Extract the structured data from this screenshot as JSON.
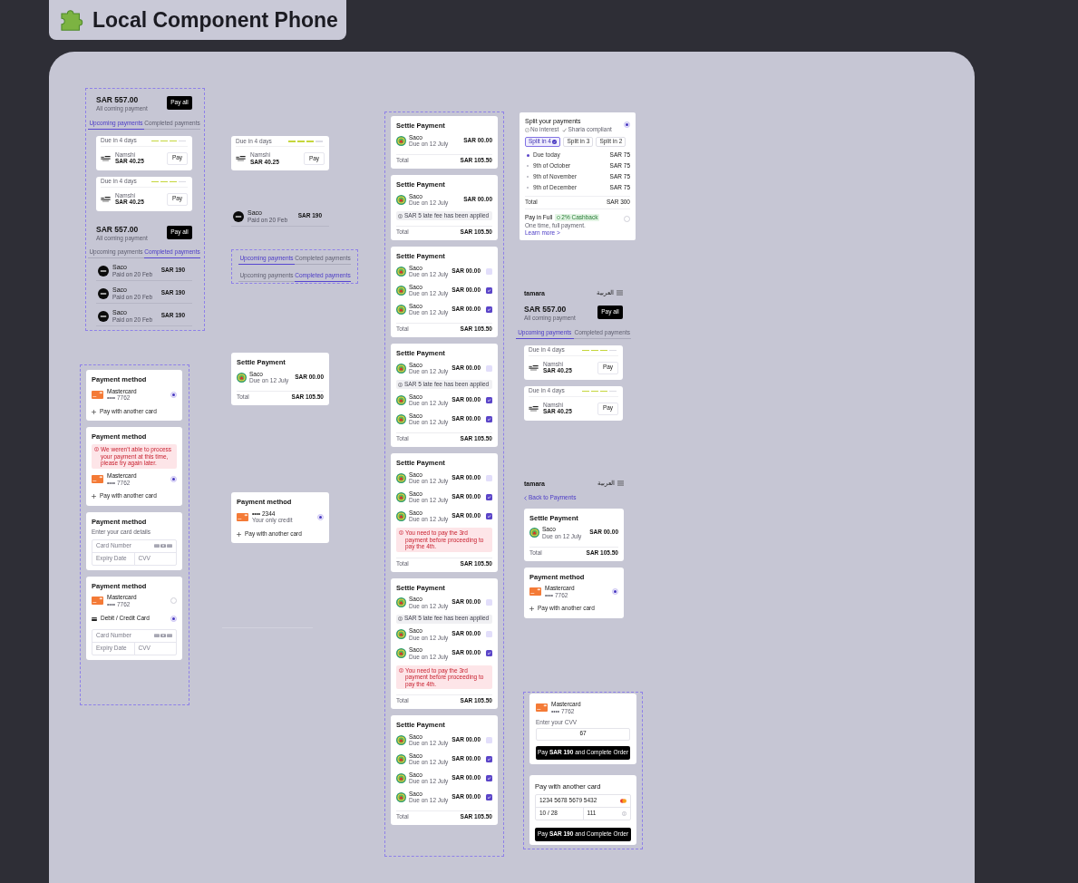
{
  "header": {
    "title": "Local Component Phone"
  },
  "frames": [
    {
      "kind": "section",
      "items": [
        {
          "kind": "balance",
          "amount": "SAR 557.00",
          "caption": "All coming payment",
          "button": "Pay all"
        },
        {
          "kind": "tabs",
          "tabs": [
            {
              "label": "Upcoming payments",
              "selected": true
            },
            {
              "label": "Completed payments",
              "selected": false
            }
          ]
        },
        {
          "kind": "due_card",
          "due": "Due in 4 days",
          "level": 0.75,
          "merchant": "Namshi",
          "amount": "SAR 40.25",
          "button": "Pay"
        },
        {
          "kind": "due_card",
          "due": "Due in 4 days",
          "level": 0.75,
          "merchant": "Namshi",
          "amount": "SAR 40.25",
          "button": "Pay"
        },
        {
          "kind": "balance",
          "amount": "SAR 557.00",
          "caption": "All coming payment",
          "button": "Pay all"
        },
        {
          "kind": "tabs",
          "tabs": [
            {
              "label": "Upcoming payments",
              "selected": false
            },
            {
              "label": "Completed payments",
              "selected": true
            }
          ]
        },
        {
          "kind": "paid_row",
          "merchant": "Saco",
          "date": "Paid on 20 Feb",
          "amount": "SAR 190"
        },
        {
          "kind": "paid_row",
          "merchant": "Saco",
          "date": "Paid on 20 Feb",
          "amount": "SAR 190"
        },
        {
          "kind": "paid_row",
          "merchant": "Saco",
          "date": "Paid on 20 Feb",
          "amount": "SAR 190"
        }
      ]
    },
    {
      "kind": "section",
      "items": [
        {
          "kind": "method_card",
          "title": "Payment method",
          "items": [
            {
              "kind": "saved_card",
              "title": "Mastercard",
              "subtitle": "•••• 7762",
              "selected": true
            },
            {
              "kind": "add_card",
              "label": "Pay with another card"
            }
          ]
        },
        {
          "kind": "method_card",
          "title": "Payment method",
          "items": [
            {
              "kind": "error",
              "text": "We weren't able to process your payment at this time, please try again later."
            },
            {
              "kind": "saved_card",
              "title": "Mastercard",
              "subtitle": "•••• 7762",
              "selected": true
            },
            {
              "kind": "add_card",
              "label": "Pay with another card"
            }
          ]
        },
        {
          "kind": "method_card",
          "title": "Payment method",
          "items": [
            {
              "kind": "hint",
              "text": "Enter your card details"
            },
            {
              "kind": "card_form",
              "fields": [
                {
                  "placeholder": "Card Number"
                },
                {
                  "placeholder": "Expiry Date"
                },
                {
                  "placeholder": "CVV"
                }
              ]
            }
          ]
        },
        {
          "kind": "method_card",
          "title": "Payment method",
          "items": [
            {
              "kind": "saved_card",
              "title": "Mastercard",
              "subtitle": "•••• 7762",
              "selected": false
            },
            {
              "kind": "new_card",
              "label": "Debit / Credit Card",
              "selected": true
            },
            {
              "kind": "card_form",
              "fields": [
                {
                  "placeholder": "Card Number"
                },
                {
                  "placeholder": "Expiry Date"
                },
                {
                  "placeholder": "CVV"
                }
              ]
            }
          ]
        }
      ]
    },
    {
      "kind": "due_card",
      "due": "Due in 4 days",
      "level": 0.75,
      "merchant": "Namshi",
      "amount": "SAR 40.25",
      "button": "Pay"
    },
    {
      "kind": "paid_row",
      "merchant": "Saco",
      "date": "Paid on 20 Feb",
      "amount": "SAR 190"
    },
    {
      "kind": "section",
      "items": [
        {
          "kind": "tabs",
          "tabs": [
            {
              "label": "Upcoming payments",
              "selected": true
            },
            {
              "label": "Completed payments",
              "selected": false
            }
          ]
        },
        {
          "kind": "tabs",
          "tabs": [
            {
              "label": "Upcoming payments",
              "selected": false
            },
            {
              "label": "Completed payments",
              "selected": true
            }
          ]
        }
      ]
    },
    {
      "kind": "settle_card",
      "title": "Settle Payment",
      "items": [
        {
          "kind": "payment",
          "merchant": "Saco",
          "date": "Due on 12 July",
          "amount": "SAR 00.00"
        }
      ],
      "total_label": "Total",
      "total": "SAR 105.50"
    },
    {
      "kind": "method_card",
      "title": "Payment method",
      "items": [
        {
          "kind": "saved_card",
          "title": "•••• 2344",
          "subtitle": "Your only credit",
          "selected": true
        },
        {
          "kind": "add_card",
          "label": "Pay with another card"
        }
      ]
    },
    {
      "kind": "section",
      "items": [
        {
          "kind": "settle_card",
          "title": "Settle Payment",
          "items": [
            {
              "kind": "payment",
              "merchant": "Saco",
              "date": "Due on 12 July",
              "amount": "SAR 00.00"
            }
          ],
          "total_label": "Total",
          "total": "SAR 105.50"
        },
        {
          "kind": "settle_card",
          "title": "Settle Payment",
          "items": [
            {
              "kind": "payment",
              "merchant": "Saco",
              "date": "Due on 12 July",
              "amount": "SAR 00.00"
            },
            {
              "kind": "info",
              "text": "SAR 5 late fee has been applied"
            }
          ],
          "total_label": "Total",
          "total": "SAR 105.50"
        },
        {
          "kind": "settle_card",
          "title": "Settle Payment",
          "items": [
            {
              "kind": "payment",
              "merchant": "Saco",
              "date": "Due on 12 July",
              "amount": "SAR 00.00",
              "checked": false
            },
            {
              "kind": "payment",
              "merchant": "Saco",
              "date": "Due on 12 July",
              "amount": "SAR 00.00",
              "checked": true
            },
            {
              "kind": "payment",
              "merchant": "Saco",
              "date": "Due on 12 July",
              "amount": "SAR 00.00",
              "checked": true
            }
          ],
          "total_label": "Total",
          "total": "SAR 105.50"
        },
        {
          "kind": "settle_card",
          "title": "Settle Payment",
          "items": [
            {
              "kind": "payment",
              "merchant": "Saco",
              "date": "Due on 12 July",
              "amount": "SAR 00.00",
              "checked": false
            },
            {
              "kind": "info",
              "text": "SAR 5 late fee has been applied"
            },
            {
              "kind": "payment",
              "merchant": "Saco",
              "date": "Due on 12 July",
              "amount": "SAR 00.00",
              "checked": true
            },
            {
              "kind": "payment",
              "merchant": "Saco",
              "date": "Due on 12 July",
              "amount": "SAR 00.00",
              "checked": true
            }
          ],
          "total_label": "Total",
          "total": "SAR 105.50"
        },
        {
          "kind": "settle_card",
          "title": "Settle Payment",
          "items": [
            {
              "kind": "payment",
              "merchant": "Saco",
              "date": "Due on 12 July",
              "amount": "SAR 00.00",
              "checked": false
            },
            {
              "kind": "payment",
              "merchant": "Saco",
              "date": "Due on 12 July",
              "amount": "SAR 00.00",
              "checked": true
            },
            {
              "kind": "payment",
              "merchant": "Saco",
              "date": "Due on 12 July",
              "amount": "SAR 00.00",
              "checked": true
            },
            {
              "kind": "error",
              "text": "You need to pay the 3rd payment before proceeding to pay the 4th."
            }
          ],
          "total_label": "Total",
          "total": "SAR 105.50"
        },
        {
          "kind": "settle_card",
          "title": "Settle Payment",
          "items": [
            {
              "kind": "payment",
              "merchant": "Saco",
              "date": "Due on 12 July",
              "amount": "SAR 00.00",
              "checked": false
            },
            {
              "kind": "info",
              "text": "SAR 5 late fee has been applied"
            },
            {
              "kind": "payment",
              "merchant": "Saco",
              "date": "Due on 12 July",
              "amount": "SAR 00.00",
              "checked": false
            },
            {
              "kind": "payment",
              "merchant": "Saco",
              "date": "Due on 12 July",
              "amount": "SAR 00.00",
              "checked": true
            },
            {
              "kind": "error",
              "text": "You need to pay the 3rd payment before proceeding to pay the 4th."
            }
          ],
          "total_label": "Total",
          "total": "SAR 105.50"
        },
        {
          "kind": "settle_card",
          "title": "Settle Payment",
          "items": [
            {
              "kind": "payment",
              "merchant": "Saco",
              "date": "Due on 12 July",
              "amount": "SAR 00.00",
              "checked": false
            },
            {
              "kind": "payment",
              "merchant": "Saco",
              "date": "Due on 12 July",
              "amount": "SAR 00.00",
              "checked": true
            },
            {
              "kind": "payment",
              "merchant": "Saco",
              "date": "Due on 12 July",
              "amount": "SAR 00.00",
              "checked": true
            },
            {
              "kind": "payment",
              "merchant": "Saco",
              "date": "Due on 12 July",
              "amount": "SAR 00.00",
              "checked": true
            }
          ],
          "total_label": "Total",
          "total": "SAR 105.50"
        }
      ]
    },
    {
      "kind": "split_card",
      "title": "Split your payments",
      "selected": true,
      "features": [
        {
          "kind": "percent",
          "text": "No interest"
        },
        {
          "kind": "check",
          "text": "Sharia compliant"
        }
      ],
      "options": [
        {
          "label": "Split in 4",
          "selected": true
        },
        {
          "label": "Split in 3",
          "selected": false
        },
        {
          "label": "Split in 2",
          "selected": false
        }
      ],
      "schedule": [
        {
          "label": "Due today",
          "amount": "SAR 75",
          "current": true
        },
        {
          "label": "9th of October",
          "amount": "SAR 75",
          "current": false
        },
        {
          "label": "9th of November",
          "amount": "SAR 75",
          "current": false
        },
        {
          "label": "9th of December",
          "amount": "SAR 75",
          "current": false
        }
      ],
      "total_label": "Total",
      "total": "SAR 300",
      "full": {
        "title": "Pay in Full",
        "badge": "2% Cashback",
        "text": "One time, full payment.",
        "link": "Learn more >",
        "selected": false
      }
    },
    {
      "kind": "app_screen",
      "logo": "tamara",
      "language": "العربية",
      "items": [
        {
          "kind": "balance",
          "amount": "SAR 557.00",
          "caption": "All coming payment",
          "button": "Pay all"
        },
        {
          "kind": "tabs",
          "tabs": [
            {
              "label": "Upcoming payments",
              "selected": true
            },
            {
              "label": "Completed payments",
              "selected": false
            }
          ]
        },
        {
          "kind": "due_card",
          "due": "Due in 4 days",
          "level": 0.75,
          "merchant": "Namshi",
          "amount": "SAR 40.25",
          "button": "Pay"
        },
        {
          "kind": "due_card",
          "due": "Due in 4 days",
          "level": 0.75,
          "merchant": "Namshi",
          "amount": "SAR 40.25",
          "button": "Pay"
        }
      ]
    },
    {
      "kind": "app_screen",
      "logo": "tamara",
      "language": "العربية",
      "back_link": "Back to Payments",
      "items": [
        {
          "kind": "settle_card",
          "title": "Settle Payment",
          "items": [
            {
              "kind": "payment",
              "merchant": "Saco",
              "date": "Due on 12 July",
              "amount": "SAR 00.00"
            }
          ],
          "total_label": "Total",
          "total": "SAR 105.50"
        },
        {
          "kind": "method_card",
          "title": "Payment method",
          "items": [
            {
              "kind": "saved_card",
              "title": "Mastercard",
              "subtitle": "•••• 7762",
              "selected": true
            },
            {
              "kind": "add_card",
              "label": "Pay with another card"
            }
          ]
        }
      ]
    },
    {
      "kind": "section",
      "items": [
        {
          "kind": "cvv_card",
          "title": "Mastercard",
          "subtitle": "•••• 7762",
          "cvv_label": "Enter your CVV",
          "cvv_value": "67",
          "button": "Pay **SAR 190** and Complete Order"
        },
        {
          "kind": "new_card_form",
          "title": "Pay with another card",
          "card_number": "1234 5678 5679 5432",
          "expiry": "10 / 28",
          "cvv": "111",
          "button": "Pay **SAR 190** and Complete Order"
        }
      ]
    }
  ]
}
